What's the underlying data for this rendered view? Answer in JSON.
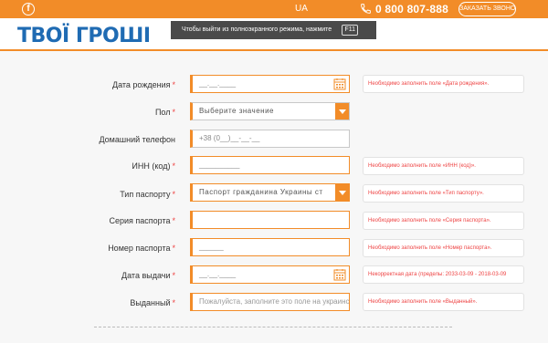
{
  "topbar": {
    "facebook_glyph": "f",
    "language": "UA",
    "phone": "0 800 807-888",
    "callback_label": "ЗАКАЗАТЬ ЗВОНОК"
  },
  "header": {
    "logo": "ТВОЇ ГРОШІ"
  },
  "fullscreen_tip": {
    "text": "Чтобы выйти из полноэкранного режима, нажмите",
    "key": "F11"
  },
  "form": {
    "required_mark": "*",
    "fields": [
      {
        "label": "Дата рождения",
        "value": "__.__.____",
        "error": "Необходимо заполнить поле «Дата рождения»."
      },
      {
        "label": "Пол",
        "value": "Выберите значение",
        "error": ""
      },
      {
        "label": "Домашний телефон",
        "value": "+38 (0__)__-__-__",
        "error": ""
      },
      {
        "label": "ИНН (код)",
        "value": "__________",
        "error": "Необходимо заполнить поле «ИНН (код)»."
      },
      {
        "label": "Тип паспорту",
        "value": "Паспорт гражданина Украины ст",
        "error": "Необходимо заполнить поле «Тип паспорту»."
      },
      {
        "label": "Серия паспорта",
        "value": "",
        "error": "Необходимо заполнить поле «Серия паспорта»."
      },
      {
        "label": "Номер паспорта",
        "value": "______",
        "error": "Необходимо заполнить поле «Номер паспорта»."
      },
      {
        "label": "Дата выдачи",
        "value": "__.__.____",
        "error": "Некорректная дата (пределы: 2033-03-09 - 2018-03-09"
      },
      {
        "label": "Выданный",
        "placeholder": "Пожалуйста, заполните это поле на украинско",
        "error": "Необходимо заполнить поле «Выданный»."
      }
    ]
  },
  "colors": {
    "accent": "#f28c28",
    "logo_blue": "#1f6bb3",
    "error_red": "#e44444"
  },
  "icons": [
    "facebook-icon",
    "phone-icon",
    "calendar-icon",
    "chevron-down-icon"
  ]
}
